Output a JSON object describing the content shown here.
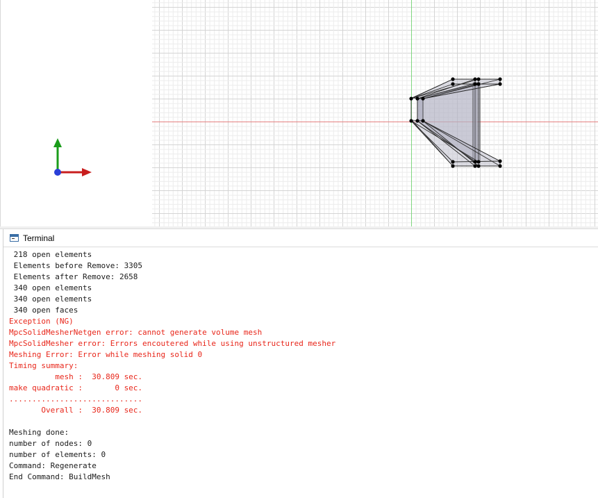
{
  "terminal": {
    "title": "Terminal",
    "lines": [
      {
        "text": " 218 open elements",
        "style": "normal"
      },
      {
        "text": " Elements before Remove: 3305",
        "style": "normal"
      },
      {
        "text": " Elements after Remove: 2658",
        "style": "normal"
      },
      {
        "text": " 340 open elements",
        "style": "normal"
      },
      {
        "text": " 340 open elements",
        "style": "normal"
      },
      {
        "text": " 340 open faces",
        "style": "normal"
      },
      {
        "text": "Exception (NG)",
        "style": "error"
      },
      {
        "text": "MpcSolidMesherNetgen error: cannot generate volume mesh",
        "style": "error"
      },
      {
        "text": "MpcSolidMesher error: Errors encoutered while using unstructured mesher",
        "style": "error"
      },
      {
        "text": "Meshing Error: Error while meshing solid 0",
        "style": "error"
      },
      {
        "text": "Timing summary:",
        "style": "error"
      },
      {
        "text": "          mesh :  30.809 sec.",
        "style": "error"
      },
      {
        "text": "make quadratic :       0 sec.",
        "style": "error"
      },
      {
        "text": ".............................",
        "style": "error"
      },
      {
        "text": "       Overall :  30.809 sec.",
        "style": "error"
      },
      {
        "text": "",
        "style": "normal"
      },
      {
        "text": "Meshing done:",
        "style": "normal"
      },
      {
        "text": "number of nodes: 0",
        "style": "normal"
      },
      {
        "text": "number of elements: 0",
        "style": "normal"
      },
      {
        "text": "Command: Regenerate",
        "style": "normal"
      },
      {
        "text": "End Command: BuildMesh",
        "style": "normal"
      }
    ]
  },
  "colors": {
    "error_text": "#e8261a",
    "normal_text": "#1a1a1a",
    "grid_minor": "#ececec",
    "grid_major": "#d4d4d4",
    "axis_x": "#e58080",
    "axis_y": "#7fd67f",
    "triad_x": "#c81e1e",
    "triad_y": "#1a9c1a",
    "triad_z": "#2a3fd8",
    "mesh_fill": "#b4b4c4",
    "mesh_edge": "#2a2a2a",
    "node": "#000000"
  },
  "icons": {
    "terminal": "terminal-icon",
    "triad": "axis-triad-icon"
  }
}
